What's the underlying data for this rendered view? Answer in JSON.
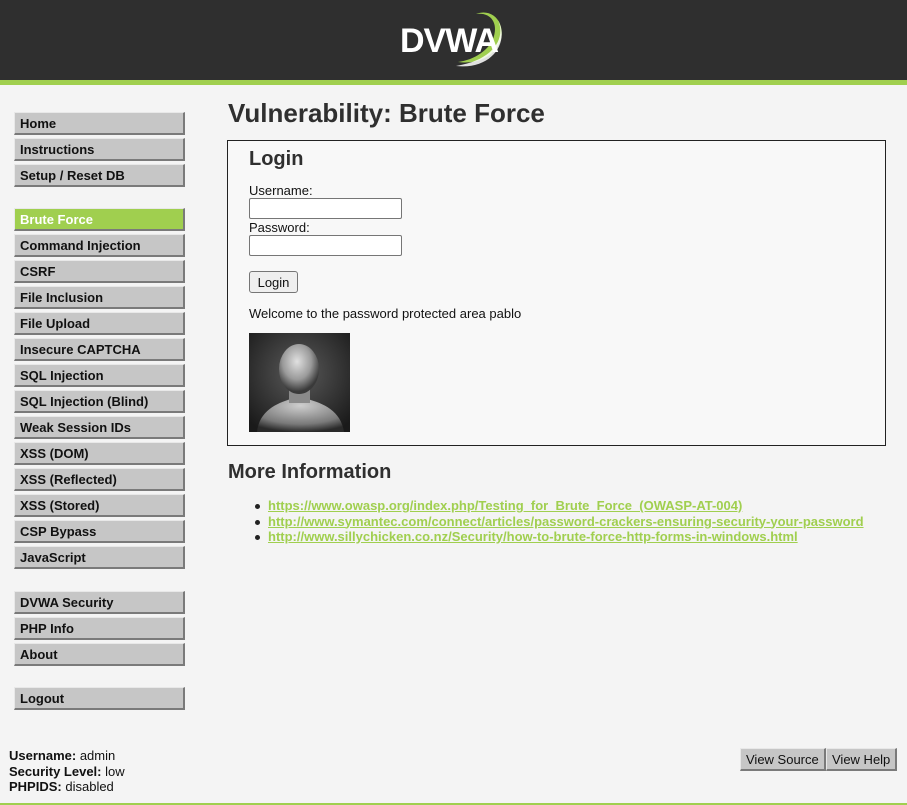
{
  "header": {
    "logo_text": "DVWA",
    "colors": {
      "background": "#2f2f2f",
      "accent": "#a0cf4f"
    }
  },
  "menu": {
    "group1": [
      {
        "label": "Home"
      },
      {
        "label": "Instructions"
      },
      {
        "label": "Setup / Reset DB"
      }
    ],
    "group2": [
      {
        "label": "Brute Force",
        "selected": true
      },
      {
        "label": "Command Injection"
      },
      {
        "label": "CSRF"
      },
      {
        "label": "File Inclusion"
      },
      {
        "label": "File Upload"
      },
      {
        "label": "Insecure CAPTCHA"
      },
      {
        "label": "SQL Injection"
      },
      {
        "label": "SQL Injection (Blind)"
      },
      {
        "label": "Weak Session IDs"
      },
      {
        "label": "XSS (DOM)"
      },
      {
        "label": "XSS (Reflected)"
      },
      {
        "label": "XSS (Stored)"
      },
      {
        "label": "CSP Bypass"
      },
      {
        "label": "JavaScript"
      }
    ],
    "group3": [
      {
        "label": "DVWA Security"
      },
      {
        "label": "PHP Info"
      },
      {
        "label": "About"
      }
    ],
    "group4": [
      {
        "label": "Logout"
      }
    ]
  },
  "main": {
    "title": "Vulnerability: Brute Force",
    "login": {
      "title": "Login",
      "username_label": "Username:",
      "username_value": "",
      "password_label": "Password:",
      "password_value": "",
      "button_label": "Login",
      "welcome_text": "Welcome to the password protected area pablo"
    },
    "more_info": {
      "title": "More Information",
      "links": [
        "https://www.owasp.org/index.php/Testing_for_Brute_Force_(OWASP-AT-004)",
        "http://www.symantec.com/connect/articles/password-crackers-ensuring-security-your-password",
        "http://www.sillychicken.co.nz/Security/how-to-brute-force-http-forms-in-windows.html"
      ]
    }
  },
  "footer": {
    "username_label": "Username:",
    "username_value": "admin",
    "security_label": "Security Level:",
    "security_value": "low",
    "phpids_label": "PHPIDS:",
    "phpids_value": "disabled",
    "view_source_label": "View Source",
    "view_help_label": "View Help"
  }
}
